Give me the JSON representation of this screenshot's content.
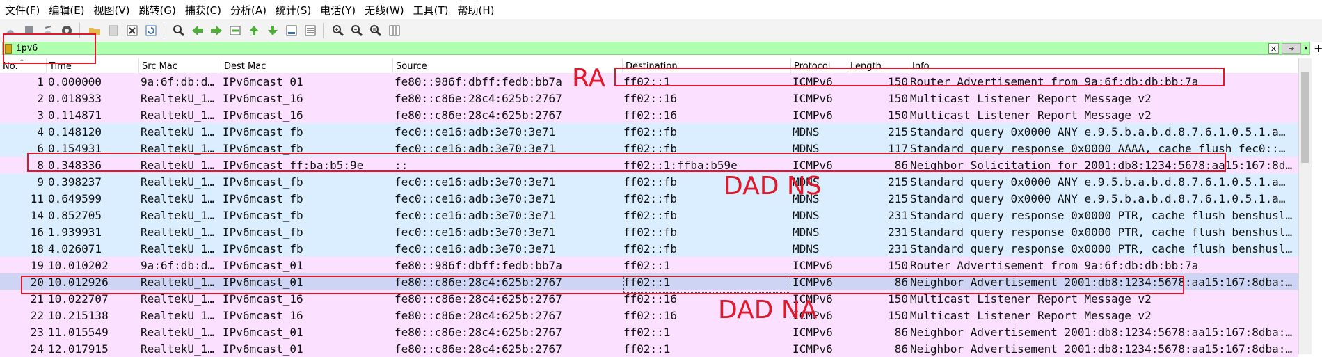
{
  "menu": [
    "文件(F)",
    "编辑(E)",
    "视图(V)",
    "跳转(G)",
    "捕获(C)",
    "分析(A)",
    "统计(S)",
    "电话(Y)",
    "无线(W)",
    "工具(T)",
    "帮助(H)"
  ],
  "toolbar_icons": [
    "shark-fin-start-icon",
    "stop-square-icon",
    "restart-fin-icon",
    "options-gear-icon",
    "open-folder-icon",
    "save-file-icon",
    "close-file-icon",
    "reload-icon",
    "find-magnifier-icon",
    "go-back-arrow-icon",
    "go-forward-arrow-icon",
    "go-to-packet-icon",
    "go-first-icon",
    "go-last-icon",
    "autoscroll-icon",
    "colorize-icon",
    "zoom-in-icon",
    "zoom-out-icon",
    "zoom-normal-icon",
    "resize-columns-icon"
  ],
  "filter": {
    "value": "ipv6"
  },
  "columns": [
    "No.",
    "Time",
    "Src Mac",
    "Dest Mac",
    "Source",
    "Destination",
    "Protocol",
    "Length",
    "Info"
  ],
  "colors": {
    "icmp": "#fce0ff",
    "udp": "#daeeff",
    "selected": "#cdd4f4",
    "annotation": "#e0182a",
    "filter_bg": "#afffaf"
  },
  "packets": [
    {
      "no": "1",
      "time": "0.000000",
      "src_mac": "9a:6f:db:d…",
      "dst_mac": "IPv6mcast_01",
      "source": "fe80::986f:dbff:fedb:bb7a",
      "destination": "ff02::1",
      "protocol": "ICMPv6",
      "length": "150",
      "info": "Router Advertisement from 9a:6f:db:db:bb:7a",
      "color": "icmp"
    },
    {
      "no": "2",
      "time": "0.018933",
      "src_mac": "RealtekU_1…",
      "dst_mac": "IPv6mcast_16",
      "source": "fe80::c86e:28c4:625b:2767",
      "destination": "ff02::16",
      "protocol": "ICMPv6",
      "length": "150",
      "info": "Multicast Listener Report Message v2",
      "color": "icmp"
    },
    {
      "no": "3",
      "time": "0.114871",
      "src_mac": "RealtekU_1…",
      "dst_mac": "IPv6mcast_16",
      "source": "fe80::c86e:28c4:625b:2767",
      "destination": "ff02::16",
      "protocol": "ICMPv6",
      "length": "150",
      "info": "Multicast Listener Report Message v2",
      "color": "icmp"
    },
    {
      "no": "4",
      "time": "0.148120",
      "src_mac": "RealtekU_1…",
      "dst_mac": "IPv6mcast_fb",
      "source": "fec0::ce16:adb:3e70:3e71",
      "destination": "ff02::fb",
      "protocol": "MDNS",
      "length": "215",
      "info": "Standard query 0x0000 ANY e.9.5.b.a.b.d.8.7.6.1.0.5.1.a…",
      "color": "udp"
    },
    {
      "no": "6",
      "time": "0.154931",
      "src_mac": "RealtekU_1…",
      "dst_mac": "IPv6mcast_fb",
      "source": "fec0::ce16:adb:3e70:3e71",
      "destination": "ff02::fb",
      "protocol": "MDNS",
      "length": "117",
      "info": "Standard query response 0x0000 AAAA, cache flush fec0::…",
      "color": "udp"
    },
    {
      "no": "8",
      "time": "0.348336",
      "src_mac": "RealtekU_1…",
      "dst_mac": "IPv6mcast_ff:ba:b5:9e",
      "source": "::",
      "destination": "ff02::1:ffba:b59e",
      "protocol": "ICMPv6",
      "length": "86",
      "info": "Neighbor Solicitation for 2001:db8:1234:5678:aa15:167:8d…",
      "color": "icmp"
    },
    {
      "no": "9",
      "time": "0.398237",
      "src_mac": "RealtekU_1…",
      "dst_mac": "IPv6mcast_fb",
      "source": "fec0::ce16:adb:3e70:3e71",
      "destination": "ff02::fb",
      "protocol": "MDNS",
      "length": "215",
      "info": "Standard query 0x0000 ANY e.9.5.b.a.b.d.8.7.6.1.0.5.1.a…",
      "color": "udp"
    },
    {
      "no": "11",
      "time": "0.649599",
      "src_mac": "RealtekU_1…",
      "dst_mac": "IPv6mcast_fb",
      "source": "fec0::ce16:adb:3e70:3e71",
      "destination": "ff02::fb",
      "protocol": "MDNS",
      "length": "215",
      "info": "Standard query 0x0000 ANY e.9.5.b.a.b.d.8.7.6.1.0.5.1.a…",
      "color": "udp"
    },
    {
      "no": "14",
      "time": "0.852705",
      "src_mac": "RealtekU_1…",
      "dst_mac": "IPv6mcast_fb",
      "source": "fec0::ce16:adb:3e70:3e71",
      "destination": "ff02::fb",
      "protocol": "MDNS",
      "length": "231",
      "info": "Standard query response 0x0000 PTR, cache flush benshusl…",
      "color": "udp"
    },
    {
      "no": "16",
      "time": "1.939931",
      "src_mac": "RealtekU_1…",
      "dst_mac": "IPv6mcast_fb",
      "source": "fec0::ce16:adb:3e70:3e71",
      "destination": "ff02::fb",
      "protocol": "MDNS",
      "length": "231",
      "info": "Standard query response 0x0000 PTR, cache flush benshusl…",
      "color": "udp"
    },
    {
      "no": "18",
      "time": "4.026071",
      "src_mac": "RealtekU_1…",
      "dst_mac": "IPv6mcast_fb",
      "source": "fec0::ce16:adb:3e70:3e71",
      "destination": "ff02::fb",
      "protocol": "MDNS",
      "length": "231",
      "info": "Standard query response 0x0000 PTR, cache flush benshusl…",
      "color": "udp"
    },
    {
      "no": "19",
      "time": "10.010202",
      "src_mac": "9a:6f:db:d…",
      "dst_mac": "IPv6mcast_01",
      "source": "fe80::986f:dbff:fedb:bb7a",
      "destination": "ff02::1",
      "protocol": "ICMPv6",
      "length": "150",
      "info": "Router Advertisement from 9a:6f:db:db:bb:7a",
      "color": "icmp"
    },
    {
      "no": "20",
      "time": "10.012926",
      "src_mac": "RealtekU_1…",
      "dst_mac": "IPv6mcast_01",
      "source": "fe80::c86e:28c4:625b:2767",
      "destination": "ff02::1",
      "protocol": "ICMPv6",
      "length": "86",
      "info": "Neighbor Advertisement 2001:db8:1234:5678:aa15:167:8dba:…",
      "color": "selected"
    },
    {
      "no": "21",
      "time": "10.022707",
      "src_mac": "RealtekU_1…",
      "dst_mac": "IPv6mcast_16",
      "source": "fe80::c86e:28c4:625b:2767",
      "destination": "ff02::16",
      "protocol": "ICMPv6",
      "length": "150",
      "info": "Multicast Listener Report Message v2",
      "color": "icmp"
    },
    {
      "no": "22",
      "time": "10.215138",
      "src_mac": "RealtekU_1…",
      "dst_mac": "IPv6mcast_16",
      "source": "fe80::c86e:28c4:625b:2767",
      "destination": "ff02::16",
      "protocol": "ICMPv6",
      "length": "150",
      "info": "Multicast Listener Report Message v2",
      "color": "icmp"
    },
    {
      "no": "23",
      "time": "11.015549",
      "src_mac": "RealtekU_1…",
      "dst_mac": "IPv6mcast_01",
      "source": "fe80::c86e:28c4:625b:2767",
      "destination": "ff02::1",
      "protocol": "ICMPv6",
      "length": "86",
      "info": "Neighbor Advertisement 2001:db8:1234:5678:aa15:167:8dba:…",
      "color": "icmp"
    },
    {
      "no": "24",
      "time": "12.017915",
      "src_mac": "RealtekU_1…",
      "dst_mac": "IPv6mcast_01",
      "source": "fe80::c86e:28c4:625b:2767",
      "destination": "ff02::1",
      "protocol": "ICMPv6",
      "length": "86",
      "info": "Neighbor Advertisement 2001:db8:1234:5678:aa15:167:8dba:…",
      "color": "icmp"
    }
  ],
  "annotations": {
    "ra": "RA",
    "dad_ns": "DAD NS",
    "dad_na": "DAD NA"
  }
}
